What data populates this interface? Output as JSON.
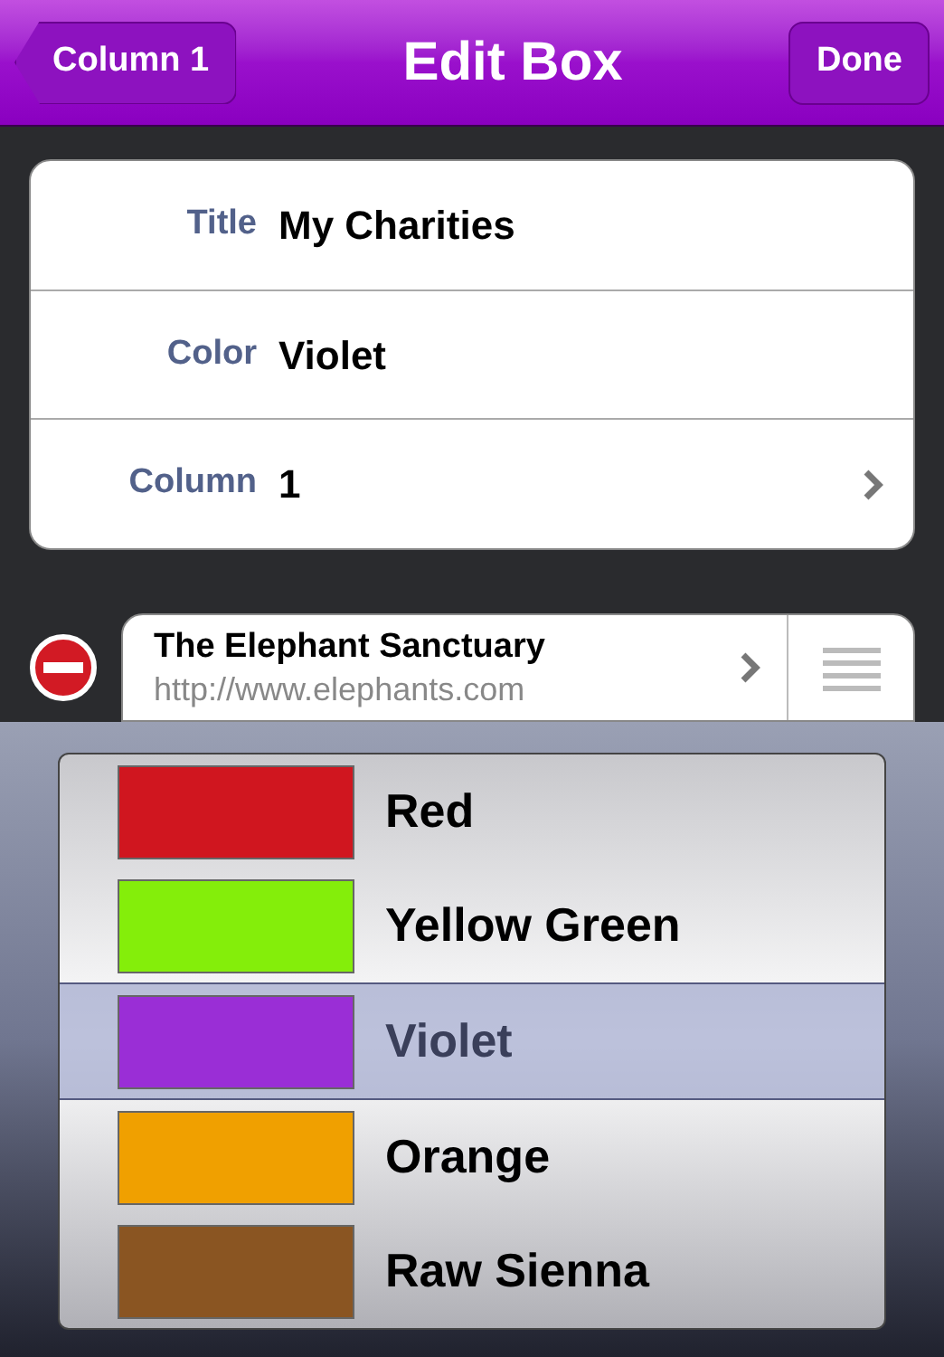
{
  "nav": {
    "back": "Column 1",
    "title": "Edit Box",
    "done": "Done"
  },
  "fields": [
    {
      "label": "Title",
      "value": "My Charities",
      "disclosure": false
    },
    {
      "label": "Color",
      "value": "Violet",
      "disclosure": false
    },
    {
      "label": "Column",
      "value": "1",
      "disclosure": true
    }
  ],
  "entry": {
    "title": "The Elephant Sanctuary",
    "url": "http://www.elephants.com"
  },
  "picker": [
    {
      "label": "Red",
      "color": "#d0161f",
      "selected": false
    },
    {
      "label": "Yellow Green",
      "color": "#84ee0a",
      "selected": false
    },
    {
      "label": "Violet",
      "color": "#9a2ed6",
      "selected": true
    },
    {
      "label": "Orange",
      "color": "#f0a000",
      "selected": false
    },
    {
      "label": "Raw Sienna",
      "color": "#8a5522",
      "selected": false
    }
  ]
}
